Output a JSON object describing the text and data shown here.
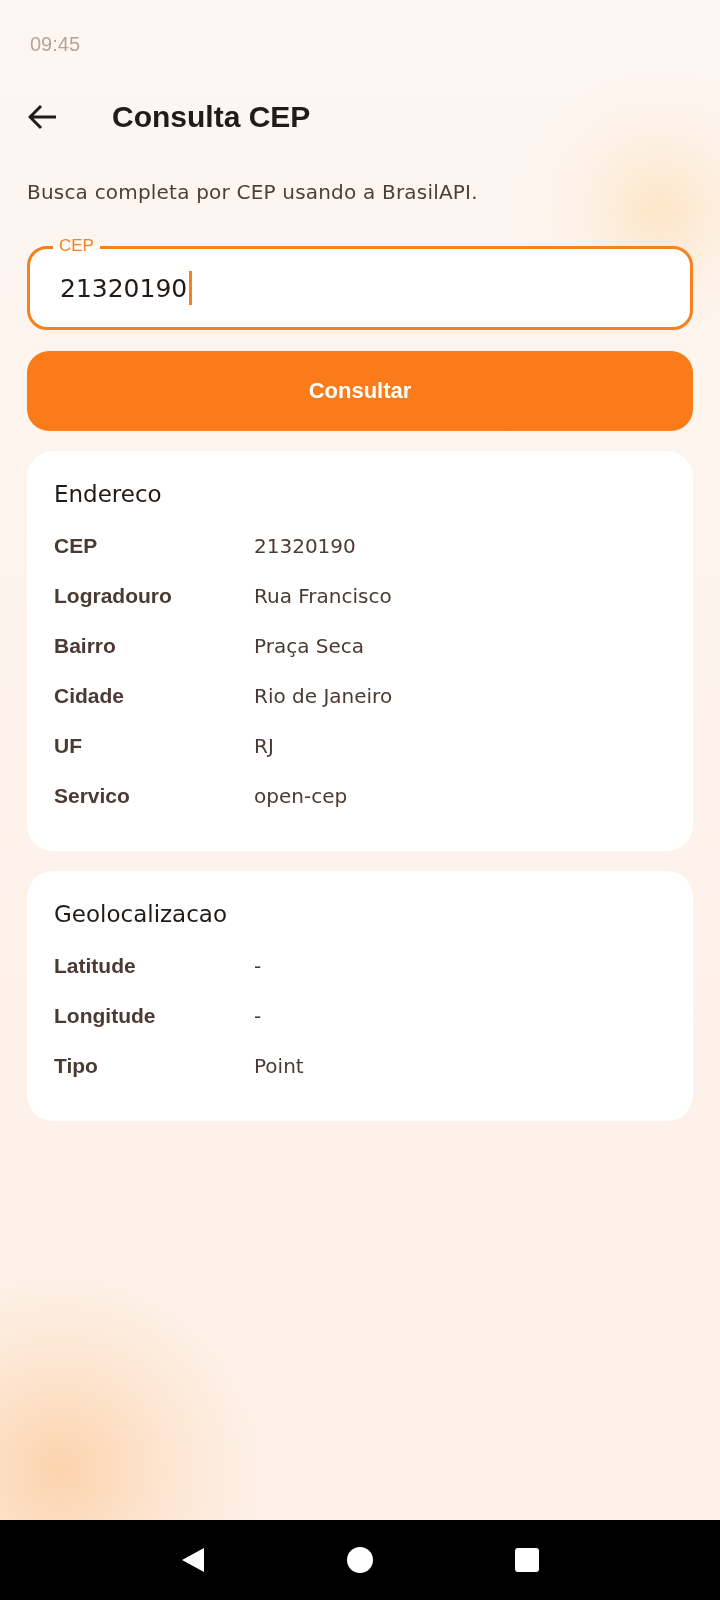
{
  "status_bar": {
    "time": "09:45"
  },
  "header": {
    "title": "Consulta CEP"
  },
  "description": "Busca completa por CEP usando a BrasilAPI.",
  "cep_field": {
    "label": "CEP",
    "value": "21320190",
    "focused": true
  },
  "submit_button": {
    "label": "Consultar"
  },
  "cards": [
    {
      "title": "Endereco",
      "rows": [
        {
          "label": "CEP",
          "value": "21320190"
        },
        {
          "label": "Logradouro",
          "value": "Rua Francisco"
        },
        {
          "label": "Bairro",
          "value": "Praça Seca"
        },
        {
          "label": "Cidade",
          "value": "Rio de Janeiro"
        },
        {
          "label": "UF",
          "value": "RJ"
        },
        {
          "label": "Servico",
          "value": "open-cep"
        }
      ]
    },
    {
      "title": "Geolocalizacao",
      "rows": [
        {
          "label": "Latitude",
          "value": "-"
        },
        {
          "label": "Longitude",
          "value": "-"
        },
        {
          "label": "Tipo",
          "value": "Point"
        }
      ]
    }
  ]
}
